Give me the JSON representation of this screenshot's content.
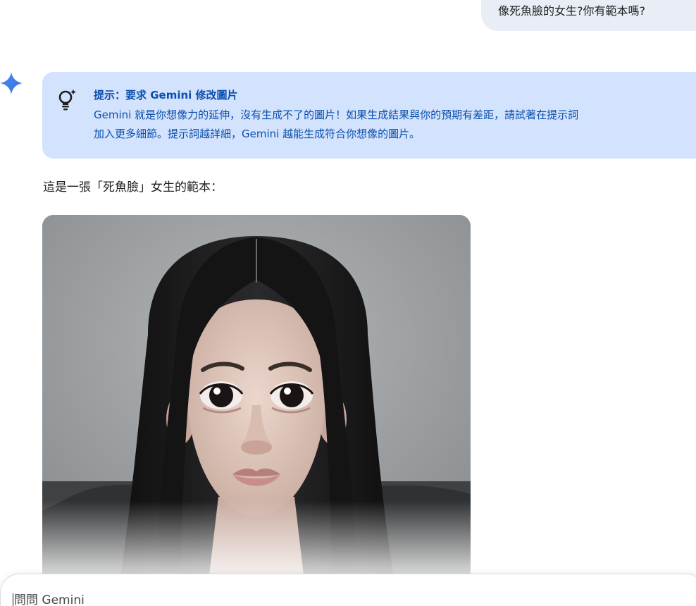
{
  "conversation": {
    "user_message": "像死魚臉的女生?你有範本嗎?",
    "tip": {
      "title": "提示：要求 Gemini 修改圖片",
      "body_line1": "Gemini 就是你想像力的延伸，沒有生成不了的圖片！如果生成結果與你的預期有差距，請試著在提示詞",
      "body_line2": "加入更多細節。提示詞越詳細，Gemini 越能生成符合你想像的圖片。"
    },
    "response_text": "這是一張「死魚臉」女生的範本："
  },
  "input": {
    "placeholder": "問問 Gemini"
  },
  "icons": {
    "assistant": "gemini-spark-icon",
    "tip": "lightbulb-sparkle-icon"
  },
  "colors": {
    "user_bubble": "#e9eef6",
    "tip_background": "#d3e3fd",
    "tip_text": "#0b4fad",
    "spark": "#4285f4"
  }
}
